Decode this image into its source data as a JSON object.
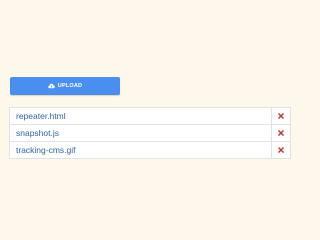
{
  "upload": {
    "label": "UPLOAD",
    "icon": "cloud-upload-icon",
    "color": "#4a8ff0"
  },
  "files": [
    {
      "name": "repeater.html",
      "remove_icon": "remove-x-icon"
    },
    {
      "name": "snapshot.js",
      "remove_icon": "remove-x-icon"
    },
    {
      "name": "tracking-cms.gif",
      "remove_icon": "remove-x-icon"
    }
  ],
  "colors": {
    "background": "#fdf8e9",
    "link": "#2f63a3",
    "remove": "#c0392b"
  }
}
